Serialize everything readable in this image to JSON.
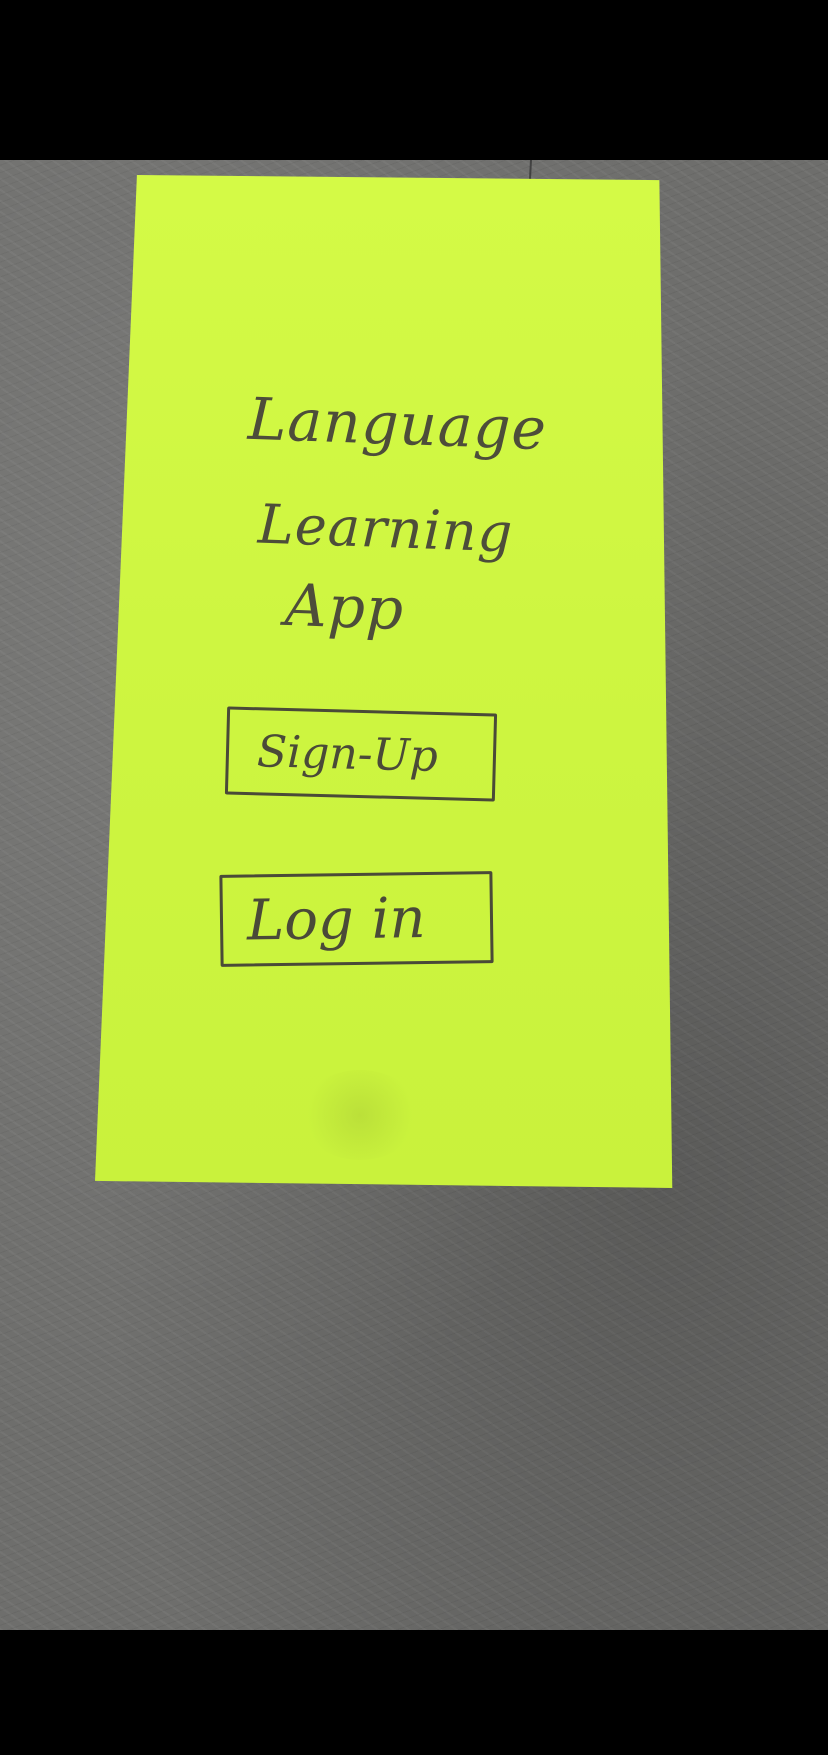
{
  "title": {
    "line1": "Language",
    "line2": "Learning",
    "line3": "App"
  },
  "buttons": {
    "signup_label": "Sign-Up",
    "login_label": "Log in"
  },
  "colors": {
    "note": "#ccf542",
    "ink": "#4a4a38",
    "surface": "#6e6e6c"
  }
}
